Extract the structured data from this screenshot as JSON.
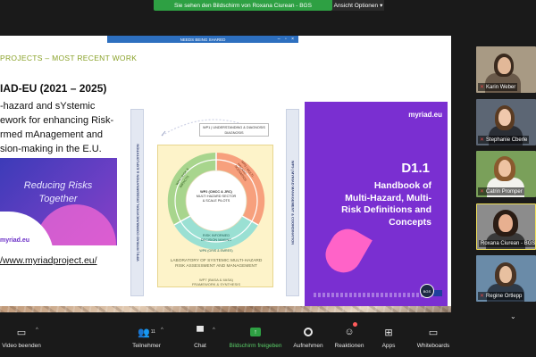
{
  "banner": {
    "share_text": "Sie sehen den Bildschirm von Roxana Ciurean - BGS",
    "view_options": "Ansicht Optionen"
  },
  "slide": {
    "header": "PROJECTS – MOST RECENT WORK",
    "project_title": "IAD-EU (2021 – 2025)",
    "description_lines": [
      "-hazard and sYstemic",
      "ework for enhancing Risk-",
      "rmed mAnagement and",
      "sion-making in the E.U."
    ],
    "reducing_text_1": "Reducing Risks",
    "reducing_text_2": "Together",
    "logo_left": "myriad.eu",
    "url": "/www.myriadproject.eu/"
  },
  "diagram": {
    "left_bar": "WP8 | MYRIAD COMMUNICATION, DISSEMINATION & EXPLOITATION",
    "right_bar": "WP9 | MYRIAD MANAGEMENT & COORDINATION",
    "wp1_line1": "WP1 | UNDERSTANDING & DIAGNOSIS",
    "wp1_line2": "DIAGNOSIS",
    "wp4": "WP4 | RISK & IMPACTS",
    "wp3": "WP3 | MULTI-HAZARD SCENARIOS",
    "wp2_line1": "WP2 (CMCC & JRC)",
    "wp2_line2": "MULTI HAZARD SECTOR",
    "wp2_line3": "& SCALE PILOTS",
    "wp5_line1": "RISK INFORMED",
    "wp5_line2": "DECISION MAKING",
    "wp6": "WP6 (GRIS & EMRES)",
    "lab_title_1": "LABORATORY OF SYSTEMIC MULTI-HAZARD",
    "lab_title_2": "RISK ASSESSMENT AND MANAGEMENT",
    "wp7_line1": "WP7 (BASA & IIASA)",
    "wp7_line2": "FRAMEWORK & SYNTHESIS"
  },
  "deliverable": {
    "logo": "myriad.eu",
    "code": "D1.1",
    "title_lines": [
      "Handbook of",
      "Multi-Hazard, Multi-",
      "Risk Definitions and",
      "Concepts"
    ]
  },
  "presenter_bar": "NEEDS BEING SHARED",
  "bgs_badge": "BGS",
  "participants": [
    {
      "name": "Karin Weber",
      "muted": true
    },
    {
      "name": "Stephanie Cberle",
      "muted": true
    },
    {
      "name": "Catrin Promper",
      "muted": true
    },
    {
      "name": "Roxana Ciurean - BGS",
      "muted": false
    },
    {
      "name": "Regine Ortlepp",
      "muted": true
    }
  ],
  "toolbar": {
    "video": "Video beenden",
    "participants": "Teilnehmer",
    "participant_count": "11",
    "chat": "Chat",
    "share": "Bildschirm freigeben",
    "record": "Aufnehmen",
    "reactions": "Reaktionen",
    "apps": "Apps",
    "whiteboards": "Whiteboards"
  },
  "colors": {
    "share_green": "#2ea043",
    "deliverable_purple": "#7a2fd1",
    "header_green": "#8aa22a",
    "accent_pink": "#ff63c8"
  }
}
